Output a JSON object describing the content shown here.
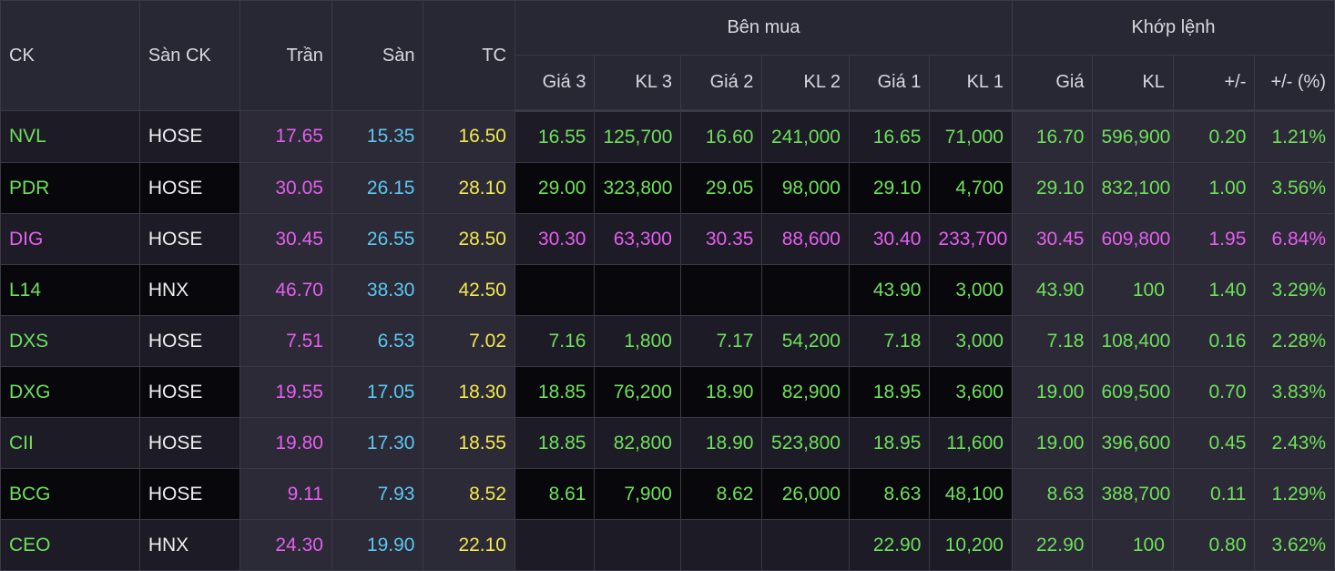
{
  "headers": {
    "ck": "CK",
    "san_ck": "Sàn CK",
    "tran": "Trần",
    "san": "Sàn",
    "tc": "TC",
    "ben_mua": "Bên mua",
    "khop_lenh": "Khớp lệnh",
    "gia3": "Giá 3",
    "kl3": "KL 3",
    "gia2": "Giá 2",
    "kl2": "KL 2",
    "gia1": "Giá 1",
    "kl1": "KL 1",
    "gia": "Giá",
    "kl": "KL",
    "change": "+/-",
    "change_pct": "+/- (%)"
  },
  "colors": {
    "up": "#6ee05a",
    "ceiling": "#e65ef0",
    "floor": "#5bc8f2",
    "reference": "#f4e84e",
    "neutral": "#eeeeee"
  },
  "rows": [
    {
      "ck": "NVL",
      "exchange": "HOSE",
      "tran": "17.65",
      "san": "15.35",
      "tc": "16.50",
      "gia3": "16.55",
      "kl3": "125,700",
      "gia2": "16.60",
      "kl2": "241,000",
      "gia1": "16.65",
      "kl1": "71,000",
      "gia": "16.70",
      "kl": "596,900",
      "change": "0.20",
      "change_pct": "1.21%",
      "status": "up"
    },
    {
      "ck": "PDR",
      "exchange": "HOSE",
      "tran": "30.05",
      "san": "26.15",
      "tc": "28.10",
      "gia3": "29.00",
      "kl3": "323,800",
      "gia2": "29.05",
      "kl2": "98,000",
      "gia1": "29.10",
      "kl1": "4,700",
      "gia": "29.10",
      "kl": "832,100",
      "change": "1.00",
      "change_pct": "3.56%",
      "status": "up"
    },
    {
      "ck": "DIG",
      "exchange": "HOSE",
      "tran": "30.45",
      "san": "26.55",
      "tc": "28.50",
      "gia3": "30.30",
      "kl3": "63,300",
      "gia2": "30.35",
      "kl2": "88,600",
      "gia1": "30.40",
      "kl1": "233,700",
      "gia": "30.45",
      "kl": "609,800",
      "change": "1.95",
      "change_pct": "6.84%",
      "status": "ceiling"
    },
    {
      "ck": "L14",
      "exchange": "HNX",
      "tran": "46.70",
      "san": "38.30",
      "tc": "42.50",
      "gia3": "",
      "kl3": "",
      "gia2": "",
      "kl2": "",
      "gia1": "43.90",
      "kl1": "3,000",
      "gia": "43.90",
      "kl": "100",
      "change": "1.40",
      "change_pct": "3.29%",
      "status": "up"
    },
    {
      "ck": "DXS",
      "exchange": "HOSE",
      "tran": "7.51",
      "san": "6.53",
      "tc": "7.02",
      "gia3": "7.16",
      "kl3": "1,800",
      "gia2": "7.17",
      "kl2": "54,200",
      "gia1": "7.18",
      "kl1": "3,000",
      "gia": "7.18",
      "kl": "108,400",
      "change": "0.16",
      "change_pct": "2.28%",
      "status": "up"
    },
    {
      "ck": "DXG",
      "exchange": "HOSE",
      "tran": "19.55",
      "san": "17.05",
      "tc": "18.30",
      "gia3": "18.85",
      "kl3": "76,200",
      "gia2": "18.90",
      "kl2": "82,900",
      "gia1": "18.95",
      "kl1": "3,600",
      "gia": "19.00",
      "kl": "609,500",
      "change": "0.70",
      "change_pct": "3.83%",
      "status": "up"
    },
    {
      "ck": "CII",
      "exchange": "HOSE",
      "tran": "19.80",
      "san": "17.30",
      "tc": "18.55",
      "gia3": "18.85",
      "kl3": "82,800",
      "gia2": "18.90",
      "kl2": "523,800",
      "gia1": "18.95",
      "kl1": "11,600",
      "gia": "19.00",
      "kl": "396,600",
      "change": "0.45",
      "change_pct": "2.43%",
      "status": "up"
    },
    {
      "ck": "BCG",
      "exchange": "HOSE",
      "tran": "9.11",
      "san": "7.93",
      "tc": "8.52",
      "gia3": "8.61",
      "kl3": "7,900",
      "gia2": "8.62",
      "kl2": "26,000",
      "gia1": "8.63",
      "kl1": "48,100",
      "gia": "8.63",
      "kl": "388,700",
      "change": "0.11",
      "change_pct": "1.29%",
      "status": "up"
    },
    {
      "ck": "CEO",
      "exchange": "HNX",
      "tran": "24.30",
      "san": "19.90",
      "tc": "22.10",
      "gia3": "",
      "kl3": "",
      "gia2": "",
      "kl2": "",
      "gia1": "22.90",
      "kl1": "10,200",
      "gia": "22.90",
      "kl": "100",
      "change": "0.80",
      "change_pct": "3.62%",
      "status": "up"
    }
  ]
}
